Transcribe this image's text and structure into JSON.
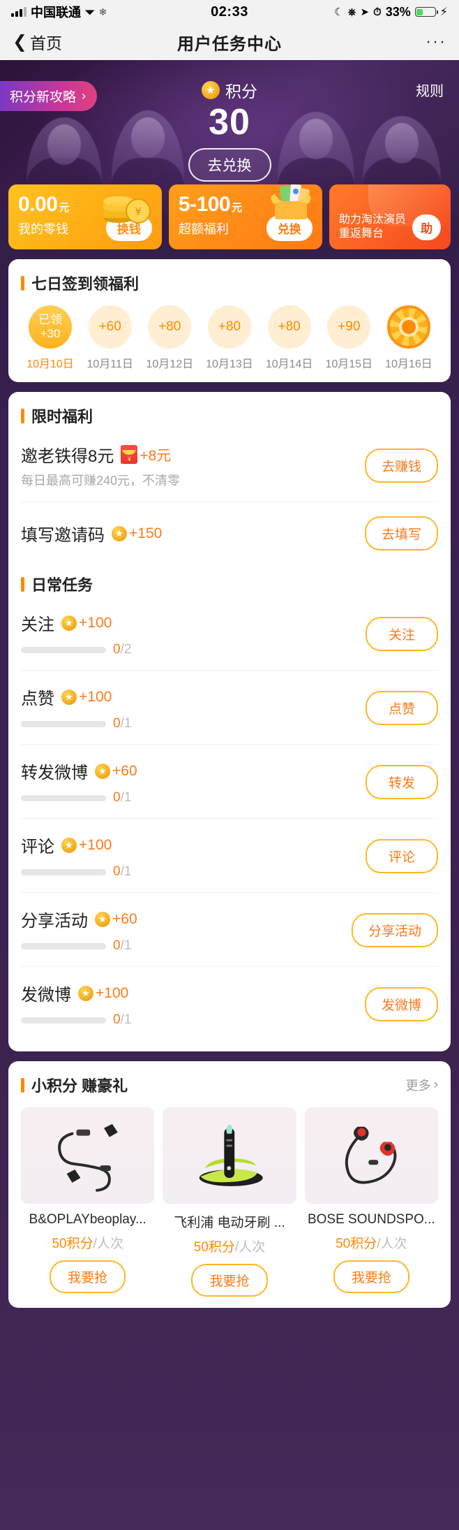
{
  "status_bar": {
    "carrier": "中国联通",
    "time": "02:33",
    "battery_percent": "33%",
    "icons": [
      "signal-bars-icon",
      "wifi-icon",
      "snowflake-icon",
      "moon-icon",
      "rotation-lock-icon",
      "location-icon",
      "alarm-icon",
      "battery-icon",
      "charging-bolt-icon"
    ]
  },
  "nav": {
    "back_label": "首页",
    "title": "用户任务中心",
    "more_label": "···"
  },
  "hero": {
    "strategy_label": "积分新攻略",
    "strategy_arrow": "›",
    "rules_label": "规则",
    "points_label": "积分",
    "points_value": "30",
    "cta_label": "去兑换"
  },
  "promos": [
    {
      "amount": "0.00",
      "unit": "元",
      "label": "我的零钱",
      "button": "换钱",
      "art": "coin-stack-icon"
    },
    {
      "amount": "5-100",
      "unit": "元",
      "label": "超额福利",
      "button": "兑换",
      "art": "gift-box-icon"
    },
    {
      "label_line1": "助力淘汰演员",
      "label_line2": "重返舞台",
      "button": "助",
      "art": "show-poster-icon"
    }
  ],
  "signin": {
    "title": "七日签到领福利",
    "days": [
      {
        "reward_top": "已领",
        "reward": "+30",
        "date": "10月10日",
        "claimed": true,
        "is_wheel": false
      },
      {
        "reward": "+60",
        "date": "10月11日",
        "claimed": false,
        "is_wheel": false
      },
      {
        "reward": "+80",
        "date": "10月12日",
        "claimed": false,
        "is_wheel": false
      },
      {
        "reward": "+80",
        "date": "10月13日",
        "claimed": false,
        "is_wheel": false
      },
      {
        "reward": "+80",
        "date": "10月14日",
        "claimed": false,
        "is_wheel": false
      },
      {
        "reward": "+90",
        "date": "10月15日",
        "claimed": false,
        "is_wheel": false
      },
      {
        "reward": "",
        "date": "10月16日",
        "claimed": false,
        "is_wheel": true
      }
    ]
  },
  "limited": {
    "title": "限时福利",
    "tasks": [
      {
        "title": "邀老铁得8元",
        "reward_icon": "red-packet-icon",
        "reward": "+8元",
        "sub": "每日最高可赚240元，不清零",
        "button": "去赚钱",
        "has_progress": false
      },
      {
        "title": "填写邀请码",
        "reward_icon": "coin-star-icon",
        "reward": "+150",
        "sub": "",
        "button": "去填写",
        "has_progress": false
      }
    ]
  },
  "daily": {
    "title": "日常任务",
    "tasks": [
      {
        "title": "关注",
        "reward_icon": "coin-star-icon",
        "reward": "+100",
        "current": "0",
        "total": "2",
        "progress_percent": 0,
        "button": "关注"
      },
      {
        "title": "点赞",
        "reward_icon": "coin-star-icon",
        "reward": "+100",
        "current": "0",
        "total": "1",
        "progress_percent": 0,
        "button": "点赞"
      },
      {
        "title": "转发微博",
        "reward_icon": "coin-star-icon",
        "reward": "+60",
        "current": "0",
        "total": "1",
        "progress_percent": 0,
        "button": "转发"
      },
      {
        "title": "评论",
        "reward_icon": "coin-star-icon",
        "reward": "+100",
        "current": "0",
        "total": "1",
        "progress_percent": 0,
        "button": "评论"
      },
      {
        "title": "分享活动",
        "reward_icon": "coin-star-icon",
        "reward": "+60",
        "current": "0",
        "total": "1",
        "progress_percent": 0,
        "button": "分享活动"
      },
      {
        "title": "发微博",
        "reward_icon": "coin-star-icon",
        "reward": "+100",
        "current": "0",
        "total": "1",
        "progress_percent": 0,
        "button": "发微博"
      }
    ]
  },
  "gifts": {
    "title": "小积分 赚豪礼",
    "more_label": "更多",
    "more_chevron": "›",
    "items": [
      {
        "name": "B&OPLAYbeoplay...",
        "price_value": "50积分",
        "price_unit": "/人次",
        "button": "我要抢",
        "thumb": "bluetooth-earphone-icon"
      },
      {
        "name": "飞利浦 电动牙刷 ...",
        "price_value": "50积分",
        "price_unit": "/人次",
        "button": "我要抢",
        "thumb": "electric-toothbrush-icon"
      },
      {
        "name": "BOSE SOUNDSPO...",
        "price_value": "50积分",
        "price_unit": "/人次",
        "button": "我要抢",
        "thumb": "sport-earphone-icon"
      }
    ]
  },
  "colors": {
    "accent_orange": "#ff8a00",
    "reward_orange": "#ff7a18",
    "purple_bg": "#3a2150",
    "card_white": "#ffffff"
  }
}
